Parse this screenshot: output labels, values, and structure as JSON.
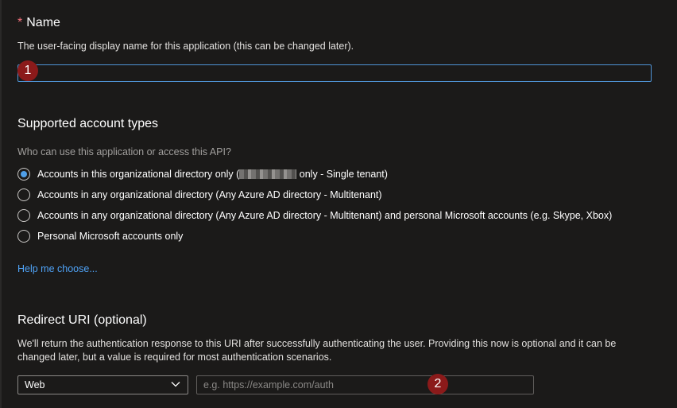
{
  "name_section": {
    "required_marker": "*",
    "title": "Name",
    "description": "The user-facing display name for this application (this can be changed later).",
    "input_value": ""
  },
  "callouts": [
    "1",
    "2"
  ],
  "account_types": {
    "title": "Supported account types",
    "question": "Who can use this application or access this API?",
    "options": [
      {
        "label_prefix": "Accounts in this organizational directory only (",
        "label_suffix": " only - Single tenant)",
        "selected": true
      },
      {
        "label": "Accounts in any organizational directory (Any Azure AD directory - Multitenant)",
        "selected": false
      },
      {
        "label": "Accounts in any organizational directory (Any Azure AD directory - Multitenant) and personal Microsoft accounts (e.g. Skype, Xbox)",
        "selected": false
      },
      {
        "label": "Personal Microsoft accounts only",
        "selected": false
      }
    ],
    "help_link": "Help me choose..."
  },
  "redirect": {
    "title": "Redirect URI (optional)",
    "description_line1": "We'll return the authentication response to this URI after successfully authenticating the user. Providing this now is optional and it can be",
    "description_line2": "changed later, but a value is required for most authentication scenarios.",
    "platform_selected": "Web",
    "uri_placeholder": "e.g. https://example.com/auth",
    "uri_value": ""
  },
  "colors": {
    "background": "#1b1a19",
    "accent": "#4f9fe8",
    "link": "#4fa3f7",
    "callout": "#8b1a1a",
    "required": "#f1707b"
  },
  "icons": {
    "select_chevron": "chevron-down-icon"
  }
}
